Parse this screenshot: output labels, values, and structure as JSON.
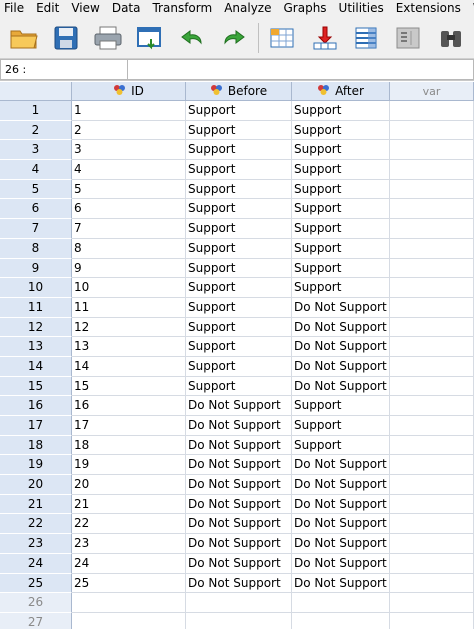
{
  "menu": [
    "File",
    "Edit",
    "View",
    "Data",
    "Transform",
    "Analyze",
    "Graphs",
    "Utilities",
    "Extensions",
    "W"
  ],
  "address": {
    "cell": "26 :"
  },
  "columns": [
    {
      "label": "ID",
      "icon": "nominal-variable-icon"
    },
    {
      "label": "Before",
      "icon": "nominal-variable-icon"
    },
    {
      "label": "After",
      "icon": "nominal-variable-icon"
    },
    {
      "label": "var",
      "icon": ""
    }
  ],
  "rows": [
    {
      "n": "1",
      "id": "1",
      "before": "Support",
      "after": "Support"
    },
    {
      "n": "2",
      "id": "2",
      "before": "Support",
      "after": "Support"
    },
    {
      "n": "3",
      "id": "3",
      "before": "Support",
      "after": "Support"
    },
    {
      "n": "4",
      "id": "4",
      "before": "Support",
      "after": "Support"
    },
    {
      "n": "5",
      "id": "5",
      "before": "Support",
      "after": "Support"
    },
    {
      "n": "6",
      "id": "6",
      "before": "Support",
      "after": "Support"
    },
    {
      "n": "7",
      "id": "7",
      "before": "Support",
      "after": "Support"
    },
    {
      "n": "8",
      "id": "8",
      "before": "Support",
      "after": "Support"
    },
    {
      "n": "9",
      "id": "9",
      "before": "Support",
      "after": "Support"
    },
    {
      "n": "10",
      "id": "10",
      "before": "Support",
      "after": "Support"
    },
    {
      "n": "11",
      "id": "11",
      "before": "Support",
      "after": "Do Not Support"
    },
    {
      "n": "12",
      "id": "12",
      "before": "Support",
      "after": "Do Not Support"
    },
    {
      "n": "13",
      "id": "13",
      "before": "Support",
      "after": "Do Not Support"
    },
    {
      "n": "14",
      "id": "14",
      "before": "Support",
      "after": "Do Not Support"
    },
    {
      "n": "15",
      "id": "15",
      "before": "Support",
      "after": "Do Not Support"
    },
    {
      "n": "16",
      "id": "16",
      "before": "Do Not Support",
      "after": "Support"
    },
    {
      "n": "17",
      "id": "17",
      "before": "Do Not Support",
      "after": "Support"
    },
    {
      "n": "18",
      "id": "18",
      "before": "Do Not Support",
      "after": "Support"
    },
    {
      "n": "19",
      "id": "19",
      "before": "Do Not Support",
      "after": "Do Not Support"
    },
    {
      "n": "20",
      "id": "20",
      "before": "Do Not Support",
      "after": "Do Not Support"
    },
    {
      "n": "21",
      "id": "21",
      "before": "Do Not Support",
      "after": "Do Not Support"
    },
    {
      "n": "22",
      "id": "22",
      "before": "Do Not Support",
      "after": "Do Not Support"
    },
    {
      "n": "23",
      "id": "23",
      "before": "Do Not Support",
      "after": "Do Not Support"
    },
    {
      "n": "24",
      "id": "24",
      "before": "Do Not Support",
      "after": "Do Not Support"
    },
    {
      "n": "25",
      "id": "25",
      "before": "Do Not Support",
      "after": "Do Not Support"
    },
    {
      "n": "26",
      "id": "",
      "before": "",
      "after": ""
    },
    {
      "n": "27",
      "id": "",
      "before": "",
      "after": ""
    }
  ],
  "toolbar_icons": [
    "open-folder-icon",
    "save-icon",
    "print-icon",
    "dialog-recall-icon",
    "undo-icon",
    "redo-icon",
    "goto-case-icon",
    "goto-variable-icon",
    "variables-icon",
    "run-descriptives-icon",
    "find-icon"
  ],
  "colors": {
    "header_bg": "#dce6f4",
    "grid_line": "#d6dbe3",
    "toolbar_bg": "#f0f0f0"
  }
}
